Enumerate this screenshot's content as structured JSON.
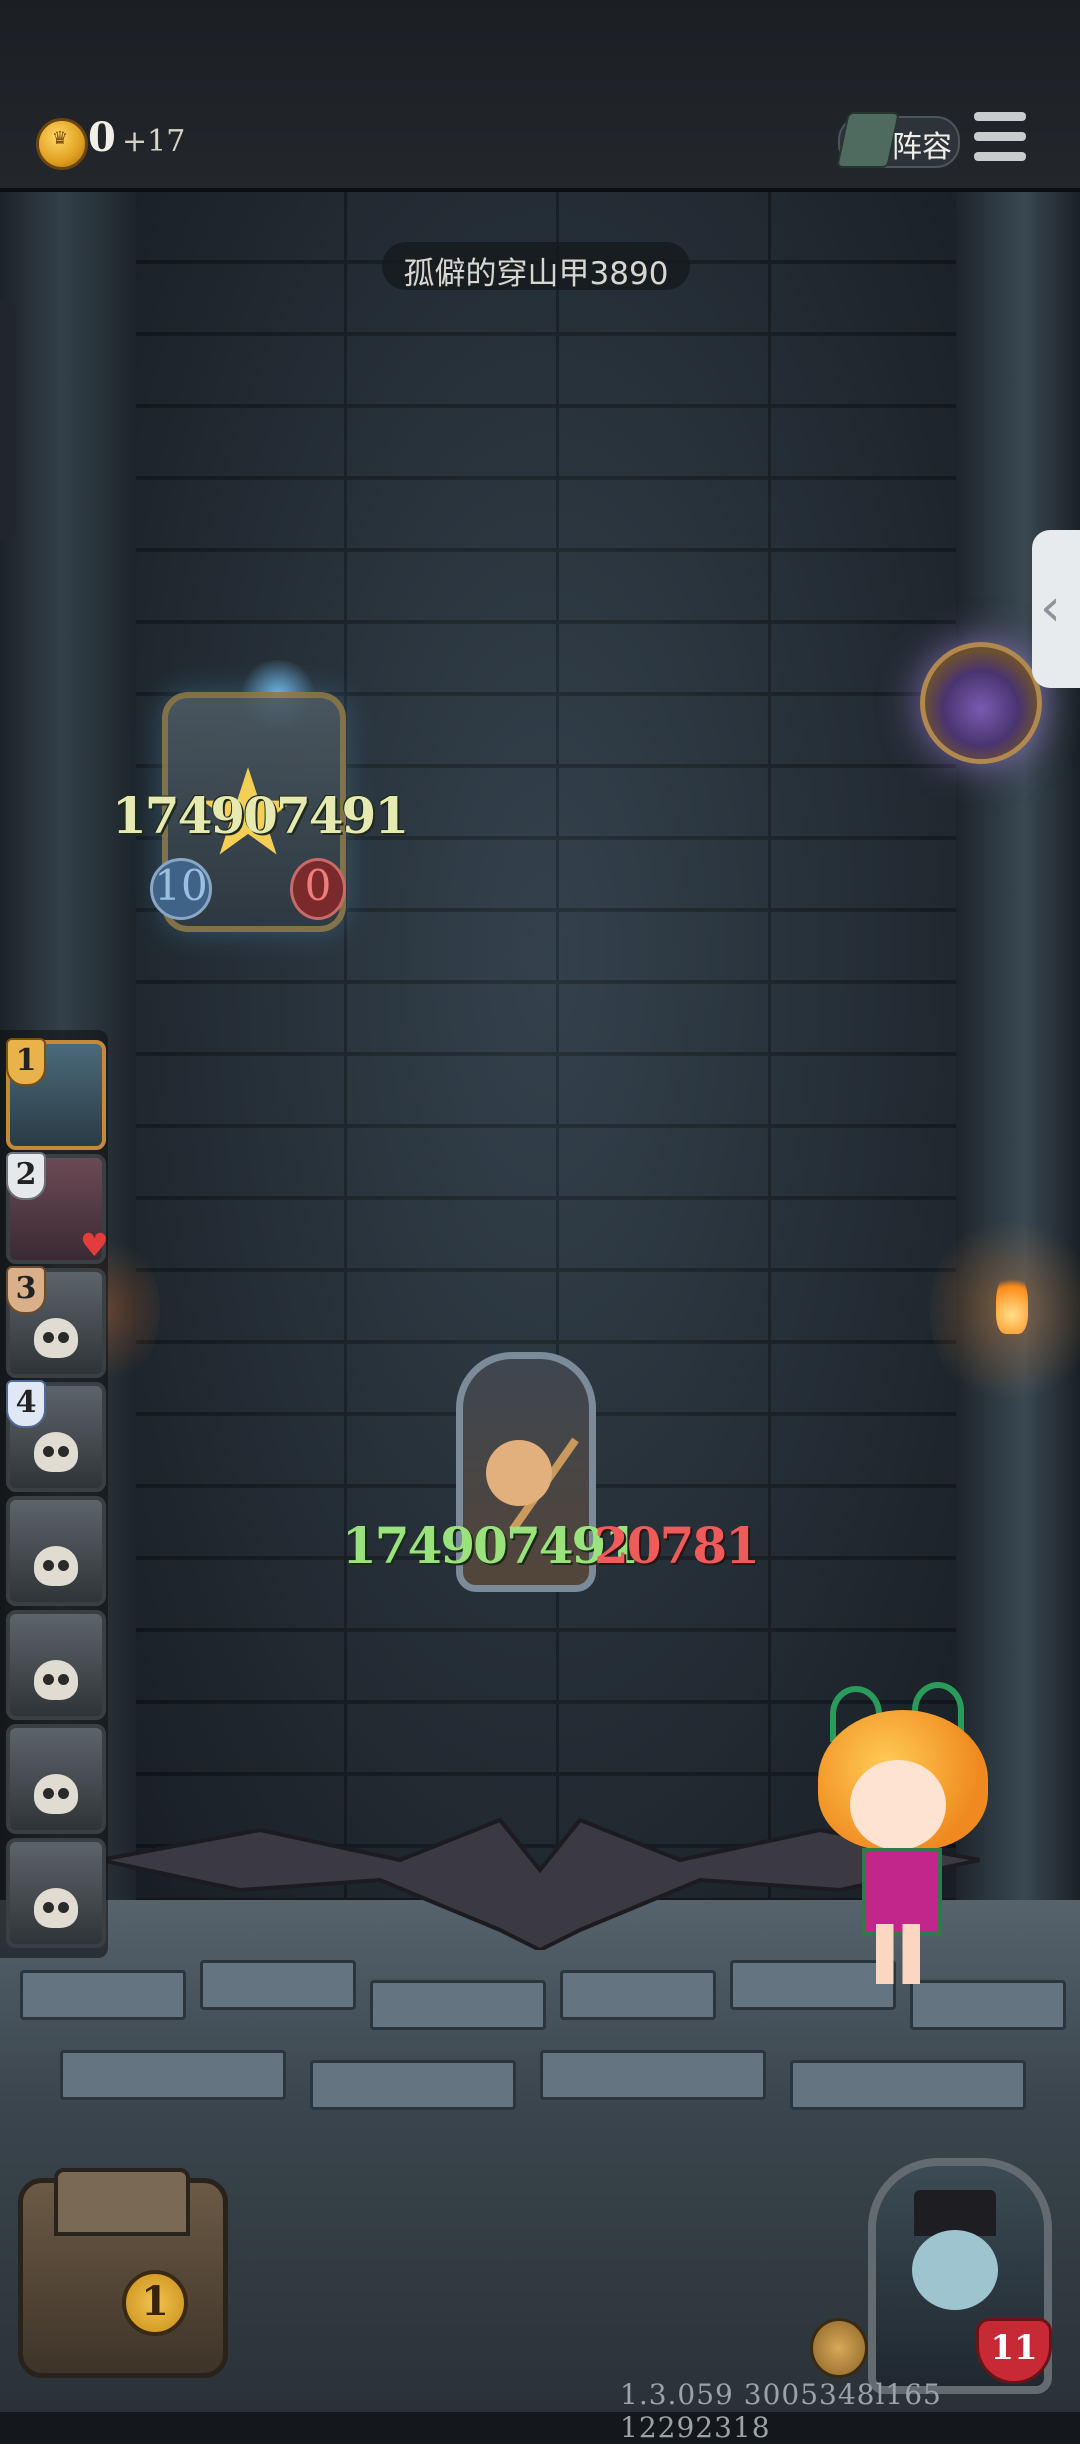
{
  "header": {
    "gold": "0",
    "income": "+17",
    "lineup_label": "阵容",
    "coin_icon": "crown-coin-icon",
    "menu_icon": "hamburger-menu-icon"
  },
  "enemy": {
    "name": "孤僻的穿山甲3890",
    "hp": "174907491",
    "attack": "10",
    "health": "0"
  },
  "player_unit": {
    "hp": "174907491",
    "attack": "20781"
  },
  "team": {
    "badges": [
      "1",
      "2",
      "3",
      "4"
    ],
    "mini_heart": "1"
  },
  "chest": {
    "count": "1"
  },
  "boss": {
    "heart": "11"
  },
  "footer": {
    "version": "1.3.059 3005348l165 12292318"
  },
  "colors": {
    "gold_text": "#f2efe6",
    "enemy_hp": "#e7eab0",
    "player_hp": "#9ae37c",
    "player_attack": "#ef5a5a"
  }
}
